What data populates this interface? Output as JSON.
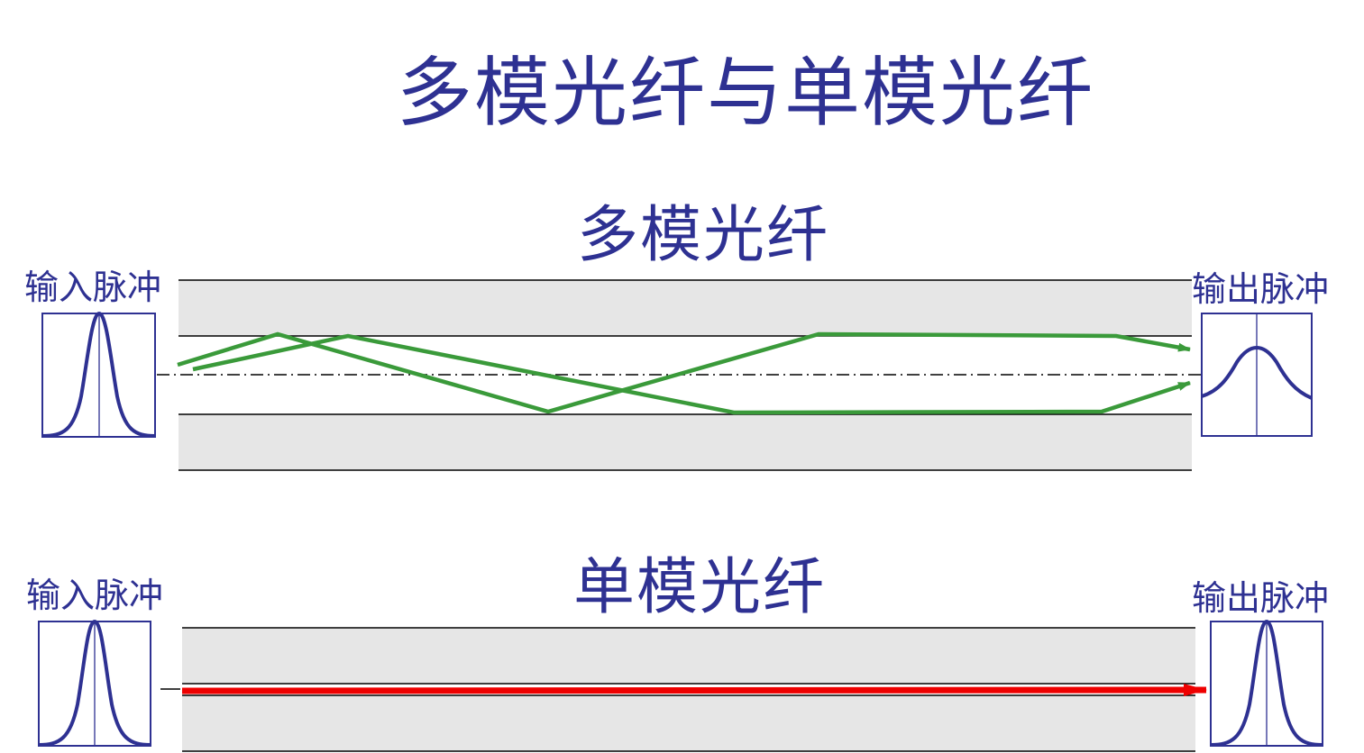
{
  "title": "多模光纤与单模光纤",
  "multimode": {
    "title": "多模光纤",
    "input_label": "输入脉冲",
    "output_label": "输出脉冲"
  },
  "singlemode": {
    "title": "单模光纤",
    "input_label": "输入脉冲",
    "output_label": "输出脉冲"
  },
  "colors": {
    "text": "#2e3192",
    "pulse": "#2e3192",
    "cladding": "#e6e6e6",
    "multimode_ray": "#3a9a3a",
    "singlemode_ray": "#ee0000"
  }
}
